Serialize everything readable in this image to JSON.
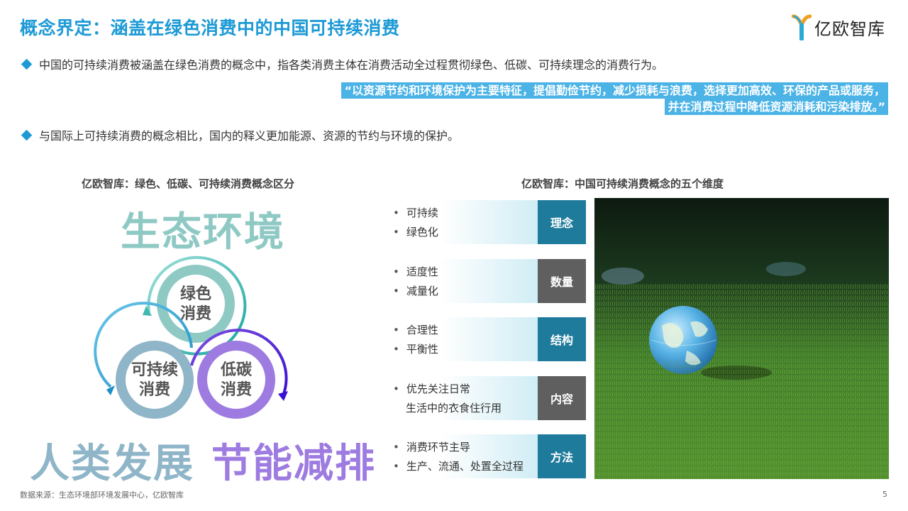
{
  "header": {
    "title": "概念界定：涵盖在绿色消费中的中国可持续消费",
    "logo_text": "亿欧智库"
  },
  "intro": {
    "bullet1": "中国的可持续消费被涵盖在绿色消费的概念中，指各类消费主体在消费活动全过程贯彻绿色、低碳、可持续理念的消费行为。",
    "quote_line1": "“以资源节约和环境保护为主要特征，提倡勤俭节约，减少损耗与浪费，选择更加高效、环保的产品或服务，",
    "quote_line2": "并在消费过程中降低资源消耗和污染排放。”",
    "bullet2": "与国际上可持续消费的概念相比，国内的释义更加能源、资源的节约与环境的保护。"
  },
  "left_chart": {
    "subtitle": "亿欧智库：绿色、低碳、可持续消费概念区分",
    "label_top": "生态环境",
    "label_bottom_left": "人类发展",
    "label_bottom_right": "节能减排",
    "circle_top": [
      "绿色",
      "消费"
    ],
    "circle_left": [
      "可持续",
      "消费"
    ],
    "circle_right": [
      "低碳",
      "消费"
    ]
  },
  "right_chart": {
    "subtitle": "亿欧智库：中国可持续消费概念的五个维度",
    "rows": [
      {
        "tag": "理念",
        "items": [
          "可持续",
          "绿色化"
        ],
        "style": "teal"
      },
      {
        "tag": "数量",
        "items": [
          "适度性",
          "减量化"
        ],
        "style": "gray"
      },
      {
        "tag": "结构",
        "items": [
          "合理性",
          "平衡性"
        ],
        "style": "teal"
      },
      {
        "tag": "内容",
        "items": [
          "优先关注日常",
          "生活中的衣食住行用"
        ],
        "style": "gray"
      },
      {
        "tag": "方法",
        "items": [
          "消费环节主导",
          "生产、流通、处置全过程"
        ],
        "style": "teal"
      }
    ]
  },
  "footer": {
    "source": "数据来源：生态环境部环境发展中心，亿欧智库",
    "page": "5"
  },
  "colors": {
    "accent": "#1d9ad6",
    "teal_tag": "#1f7b9c",
    "gray_tag": "#5f5f5f",
    "green_circle": "#8fc9c4",
    "blue_circle": "#8fb5c8",
    "purple_circle": "#9d7be0"
  }
}
